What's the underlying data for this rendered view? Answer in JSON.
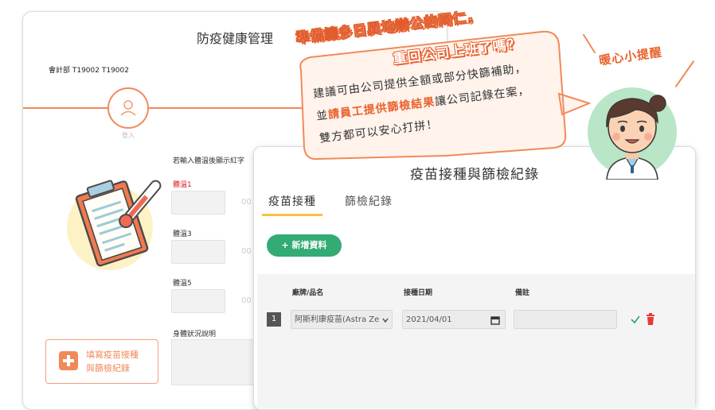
{
  "back_panel": {
    "title": "防疫健康管理",
    "department": "會計部 T19002 T19002",
    "avatar_caption": "登入",
    "temperature_hint": "若輸入體溫後顯示紅字",
    "temperature_fields": [
      {
        "label": "體溫1",
        "label_color": "#e02020",
        "unit": "00"
      },
      {
        "label": "體溫3",
        "label_color": "#333333",
        "unit": "00"
      },
      {
        "label": "體溫5",
        "label_color": "#333333",
        "unit": "00"
      }
    ],
    "body_status_label": "身體狀況說明",
    "fill_button": {
      "line1": "填寫疫苗接種",
      "line2": "與篩檢紀錄",
      "icon": "plus-icon"
    }
  },
  "front_panel": {
    "title": "疫苗接種與篩檢紀錄",
    "tabs": [
      {
        "label": "疫苗接種",
        "active": true
      },
      {
        "label": "篩檢紀錄",
        "active": false
      }
    ],
    "add_button": "+ 新增資料",
    "table": {
      "headers": [
        "廠牌/品名",
        "接種日期",
        "備註"
      ],
      "rows": [
        {
          "index": "1",
          "brand": "阿斯利康疫苗(Astra Ze",
          "date": "2021/04/01",
          "note": ""
        }
      ]
    }
  },
  "bubble": {
    "headline_line1": "準備讓多日異地辦公的同仁，",
    "headline_line2": "重回公司上班了嗎？",
    "body_line1": "建議可由公司提供全額或部分快篩補助，",
    "body_line2_prefix": "並",
    "body_line2_highlight": "請員工提供篩檢結果",
    "body_line2_suffix": "讓公司記錄在案，",
    "body_line3": "雙方都可以安心打拼！"
  },
  "tip_label": "暖心小提醒",
  "colors": {
    "accent_orange": "#f08a5a",
    "highlight_orange": "#e9622c",
    "green": "#33ab74",
    "tab_underline": "#f5c242"
  }
}
